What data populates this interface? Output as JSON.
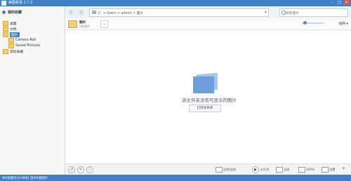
{
  "window": {
    "title": "美图看看 2.7.2"
  },
  "sidebar": {
    "header": "我的收藏",
    "items": [
      {
        "label": "桌面",
        "selected": false
      },
      {
        "label": "文档",
        "selected": false
      },
      {
        "label": "图片",
        "selected": true
      },
      {
        "label": "Camera Roll",
        "selected": false,
        "child": true
      },
      {
        "label": "Saved Pictures",
        "selected": false,
        "child": true
      },
      {
        "label": "其他收藏",
        "selected": false
      }
    ]
  },
  "toolbar": {
    "address": "C: > Users > admin > 图片",
    "search_placeholder": "搜索图片"
  },
  "subtoolbar": {
    "folder_name": "图片",
    "folder_count": "0张图片",
    "sort_label": "排序"
  },
  "content": {
    "empty_message": "该文件夹没有可显示的图片",
    "open_folder_button": "打开文件夹"
  },
  "bottombar": {
    "left_icons": [
      "↺",
      "✎",
      "ⓘ"
    ],
    "rotate_label": "左转/右转",
    "slideshow_label": "幻灯片",
    "fullscreen_label": "全屏",
    "zoom_label": "100%",
    "settings_label": "设置"
  },
  "statusbar": {
    "text": "共0张图片(0.0MB)  选中0张图片"
  }
}
